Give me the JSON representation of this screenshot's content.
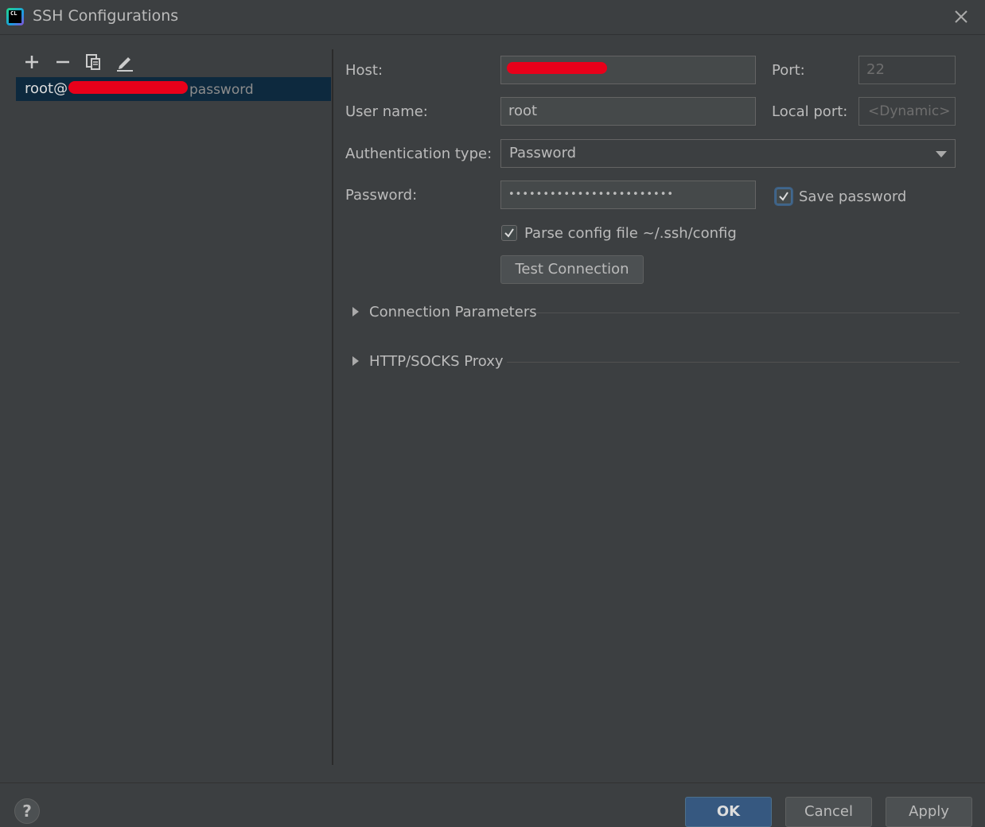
{
  "window": {
    "title": "SSH Configurations"
  },
  "icons": {
    "app": "clion-app-icon",
    "close": "close-icon",
    "add": "plus-icon",
    "remove": "minus-icon",
    "copy": "copy-icon",
    "edit": "pencil-icon",
    "dropdown": "chevron-down-icon",
    "expand": "triangle-right-icon",
    "help": "help-icon"
  },
  "app_icon_text": "CL",
  "sidebar": {
    "items": [
      {
        "label": "root@",
        "sub": "password",
        "selected": true
      }
    ]
  },
  "form": {
    "host_label": "Host:",
    "host_value": "",
    "port_label": "Port:",
    "port_value": "22",
    "username_label": "User name:",
    "username_value": "root",
    "local_port_label": "Local port:",
    "local_port_value": "<Dynamic>",
    "auth_type_label": "Authentication type:",
    "auth_type_value": "Password",
    "password_label": "Password:",
    "password_value": "••••••••••••••••••••••••",
    "save_password_label": "Save password",
    "save_password_checked": true,
    "parse_config_label": "Parse config file ~/.ssh/config",
    "parse_config_checked": true,
    "test_connection_label": "Test Connection"
  },
  "sections": [
    {
      "label": "Connection Parameters",
      "expanded": false
    },
    {
      "label": "HTTP/SOCKS Proxy",
      "expanded": false
    }
  ],
  "footer": {
    "help_label": "?",
    "ok_label": "OK",
    "cancel_label": "Cancel",
    "apply_label": "Apply"
  },
  "colors": {
    "background": "#3c3f41",
    "selection": "#0d293e",
    "primary_button": "#365880",
    "redaction": "#e8001a"
  }
}
